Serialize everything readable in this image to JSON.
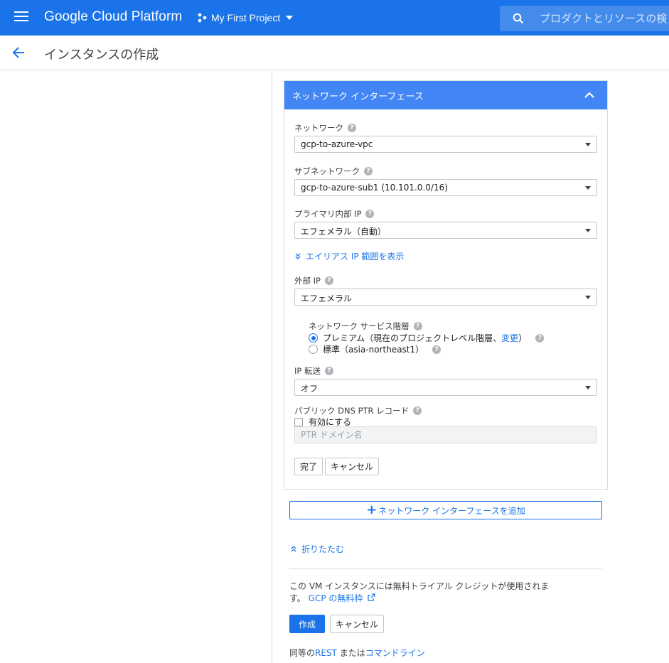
{
  "appbar": {
    "brand": "Google Cloud Platform",
    "project": "My First Project",
    "search_placeholder": "プロダクトとリソースの検"
  },
  "page": {
    "title": "インスタンスの作成"
  },
  "network_interface": {
    "header": "ネットワーク インターフェース",
    "network_label": "ネットワーク",
    "network_value": "gcp-to-azure-vpc",
    "subnet_label": "サブネットワーク",
    "subnet_value": "gcp-to-azure-sub1 (10.101.0.0/16)",
    "primary_ip_label": "プライマリ内部 IP",
    "primary_ip_value": "エフェメラル（自動）",
    "alias_link": "エイリアス IP 範囲を表示",
    "external_ip_label": "外部 IP",
    "external_ip_value": "エフェメラル",
    "tier_label": "ネットワーク サービス階層",
    "tier_premium_prefix": "プレミアム（現在のプロジェクトレベル階層、",
    "tier_premium_link": "変更",
    "tier_premium_suffix": "）",
    "tier_standard": "標準（asia-northeast1）",
    "ip_forwarding_label": "IP 転送",
    "ip_forwarding_value": "オフ",
    "dns_ptr_label": "パブリック DNS PTR レコード",
    "dns_enable_label": "有効にする",
    "ptr_placeholder": "PTR ドメイン名",
    "done_button": "完了",
    "cancel_button": "キャンセル"
  },
  "add_interface_button": "ネットワーク インターフェースを追加",
  "collapse_link": "折りたたむ",
  "trial_text": "この VM インスタンスには無料トライアル クレジットが使用されます。",
  "trial_link": "GCP の無料枠",
  "create_button": "作成",
  "cancel_button": "キャンセル",
  "equivalent": {
    "prefix": "同等の",
    "rest_link": "REST",
    "middle": "または",
    "cmd_link": "コマンドライン"
  },
  "colors": {
    "primary": "#1a73e8",
    "card_header": "#4285f4"
  },
  "icons": [
    "menu-icon",
    "project-dots-icon",
    "search-icon",
    "back-arrow-icon",
    "chevron-up-icon",
    "help-icon",
    "chevron-down-double-icon",
    "plus-icon",
    "chevron-up-double-icon",
    "external-link-icon"
  ]
}
